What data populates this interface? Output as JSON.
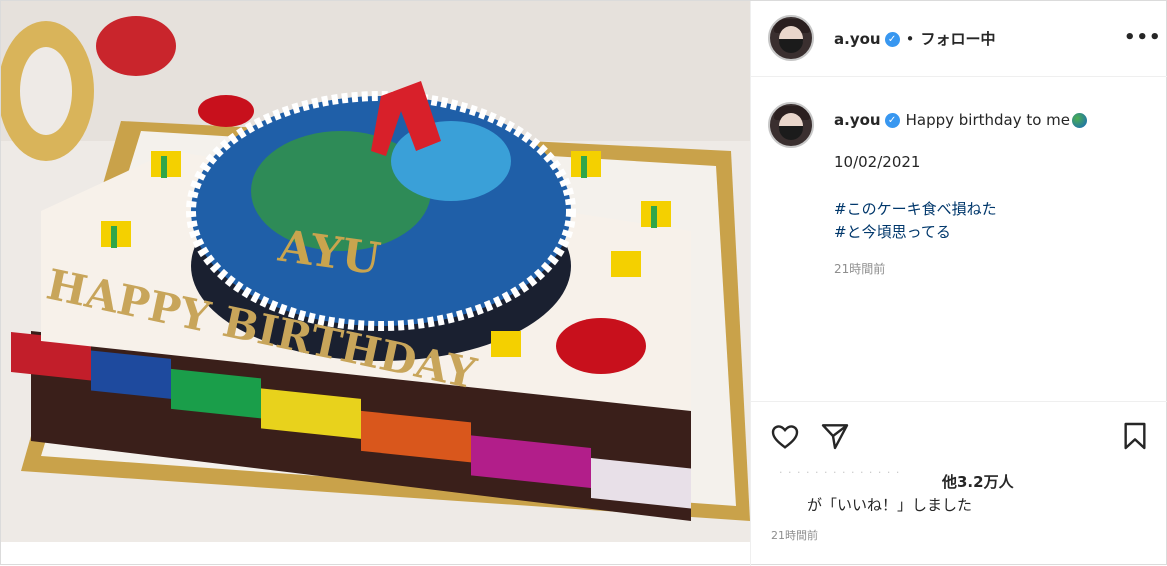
{
  "header": {
    "username": "a.you",
    "separator": "•",
    "follow_status": "フォロー中",
    "more_label": "•••"
  },
  "post": {
    "username": "a.you",
    "caption": "Happy birthday to me",
    "date": "10/02/2021",
    "hashtags": [
      "#このケーキ食べ損ねた",
      "#と今頃思ってる"
    ],
    "time_ago": "21時間前"
  },
  "image": {
    "cake_topper": "AYU",
    "cake_text": "HAPPY BIRTHDAY"
  },
  "likes": {
    "ghost_text": "· · · · · · · · · · · · · ·",
    "count": "他3.2万人",
    "suffix": "が「いいね！」しました",
    "time_ago": "21時間前"
  },
  "icons": {
    "verified": "verified-badge-icon",
    "like": "heart-icon",
    "share": "paper-plane-icon",
    "save": "bookmark-icon",
    "more": "more-options-icon"
  },
  "colors": {
    "link": "#00376b",
    "verified": "#3897f0",
    "muted": "#8e8e8e"
  }
}
